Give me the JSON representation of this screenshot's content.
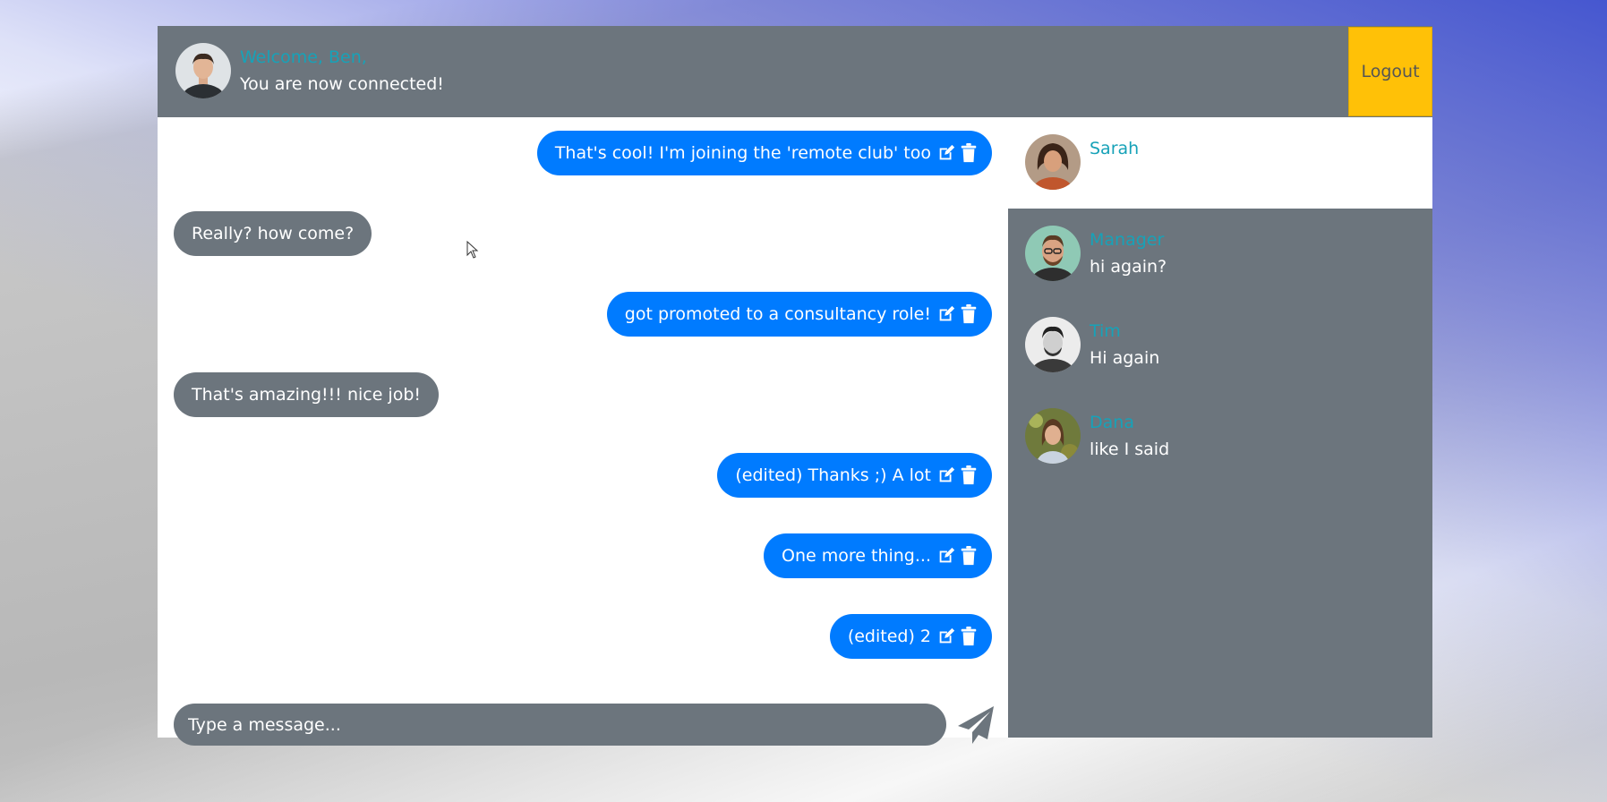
{
  "header": {
    "welcome": "Welcome, Ben,",
    "status": "You are now connected!",
    "logout_label": "Logout"
  },
  "messages": [
    {
      "text": "That's cool! I'm joining the 'remote club' too",
      "direction": "outgoing"
    },
    {
      "text": "Really? how come?",
      "direction": "incoming"
    },
    {
      "text": "got promoted to a consultancy role!",
      "direction": "outgoing"
    },
    {
      "text": "That's amazing!!! nice job!",
      "direction": "incoming"
    },
    {
      "text": "(edited) Thanks ;) A lot",
      "direction": "outgoing"
    },
    {
      "text": "One more thing...",
      "direction": "outgoing"
    },
    {
      "text": "(edited) 2",
      "direction": "outgoing"
    }
  ],
  "composer": {
    "placeholder": "Type a message..."
  },
  "contacts": [
    {
      "name": "Sarah",
      "last_message": "",
      "active": true
    },
    {
      "name": "Manager",
      "last_message": "hi again?",
      "active": false
    },
    {
      "name": "Tim",
      "last_message": "Hi again",
      "active": false
    },
    {
      "name": "Dana",
      "last_message": "like I said",
      "active": false
    }
  ],
  "colors": {
    "header_bg": "#6c757d",
    "accent_name": "#17a2b8",
    "outgoing_bubble": "#007bff",
    "incoming_bubble": "#6c757d",
    "logout_button": "#ffc107"
  },
  "icons": {
    "edit": "edit-icon",
    "delete": "trash-icon",
    "send": "paper-plane-icon"
  }
}
